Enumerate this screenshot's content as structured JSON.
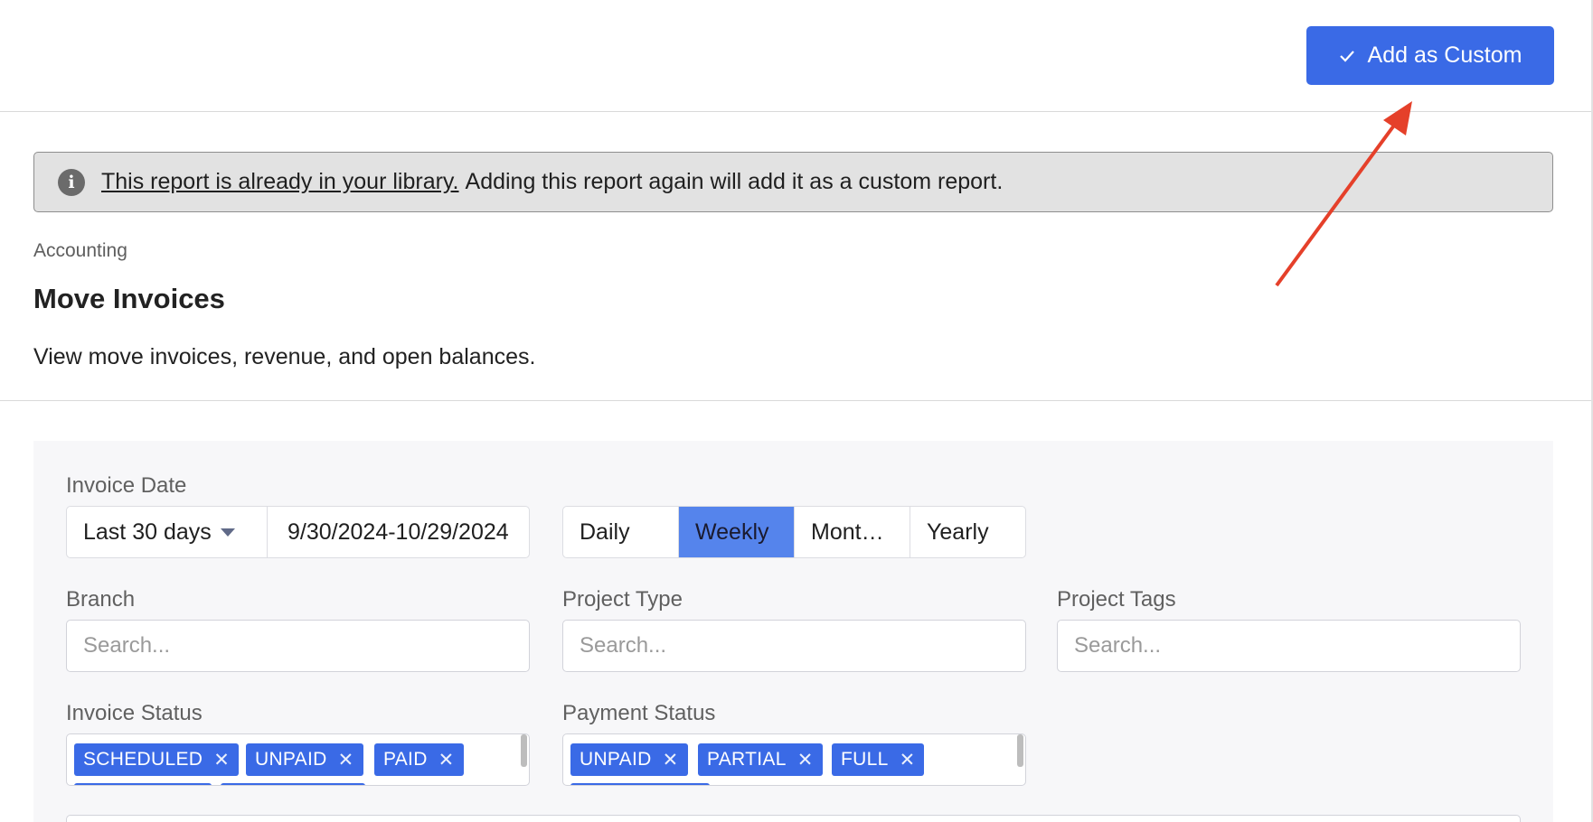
{
  "header": {
    "add_custom_label": "Add as Custom"
  },
  "notice": {
    "link_text": "This report is already in your library.",
    "message": "Adding this report again will add it as a custom report."
  },
  "report": {
    "category": "Accounting",
    "title": "Move Invoices",
    "description": "View move invoices, revenue, and open balances."
  },
  "filters": {
    "invoice_date": {
      "label": "Invoice Date",
      "range": "Last 30 days",
      "value": "9/30/2024-10/29/2024"
    },
    "interval": {
      "options": [
        "Daily",
        "Weekly",
        "Mont…",
        "Yearly"
      ],
      "selected": "Weekly"
    },
    "branch": {
      "label": "Branch",
      "placeholder": "Search..."
    },
    "project_type": {
      "label": "Project Type",
      "placeholder": "Search..."
    },
    "project_tags": {
      "label": "Project Tags",
      "placeholder": "Search..."
    },
    "invoice_status": {
      "label": "Invoice Status",
      "tags": [
        "SCHEDULED",
        "UNPAID",
        "PAID"
      ]
    },
    "payment_status": {
      "label": "Payment Status",
      "tags": [
        "UNPAID",
        "PARTIAL",
        "FULL"
      ]
    }
  },
  "icons": {
    "check": "check-icon",
    "info": "info-icon",
    "remove": "close-icon",
    "dropdown": "caret-down-icon"
  },
  "colors": {
    "primary": "#3a6ae6",
    "selected_segment": "#5584ec",
    "annotation_arrow": "#e5402a"
  }
}
